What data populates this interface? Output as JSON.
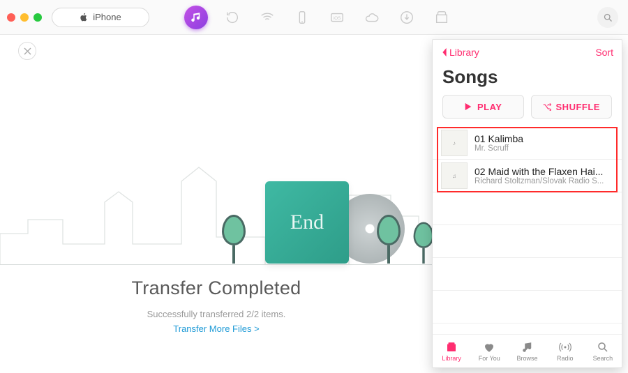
{
  "toolbar": {
    "device_label": "iPhone"
  },
  "status": {
    "title": "Transfer Completed",
    "subtitle": "Successfully transferred 2/2 items.",
    "link_label": "Transfer More Files >",
    "card_word": "End"
  },
  "phone": {
    "back_label": "Library",
    "sort_label": "Sort",
    "heading": "Songs",
    "play_label": "PLAY",
    "shuffle_label": "SHUFFLE",
    "songs": [
      {
        "title": "01 Kalimba",
        "artist": "Mr. Scruff"
      },
      {
        "title": "02 Maid with the Flaxen Hai...",
        "artist": "Richard Stoltzman/Slovak Radio S..."
      }
    ],
    "tabs": [
      {
        "label": "Library"
      },
      {
        "label": "For You"
      },
      {
        "label": "Browse"
      },
      {
        "label": "Radio"
      },
      {
        "label": "Search"
      }
    ]
  }
}
